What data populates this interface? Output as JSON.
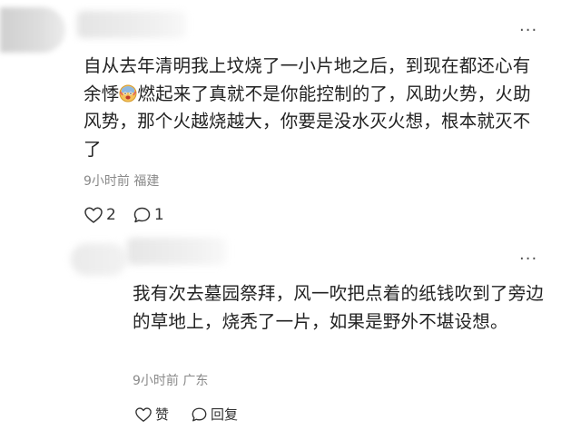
{
  "main_comment": {
    "more_label": "···",
    "text_before_emoji": "自从去年清明我上坟烧了一小片地之后，到现在都还心有余悸",
    "emoji": "scared-face-emoji",
    "text_after_emoji": "燃起来了真就不是你能控制的了，风助火势，火助风势，那个火越烧越大，你要是没水灭火想，根本就灭不了",
    "meta": "9小时前 福建",
    "likes": "2",
    "replies": "1"
  },
  "reply": {
    "more_label": "···",
    "text": "我有次去墓园祭拜，风一吹把点着的纸钱吹到了旁边的草地上，烧秃了一片，如果是野外不堪设想。",
    "meta": "9小时前 广东",
    "like_label": "赞",
    "reply_label": "回复"
  }
}
